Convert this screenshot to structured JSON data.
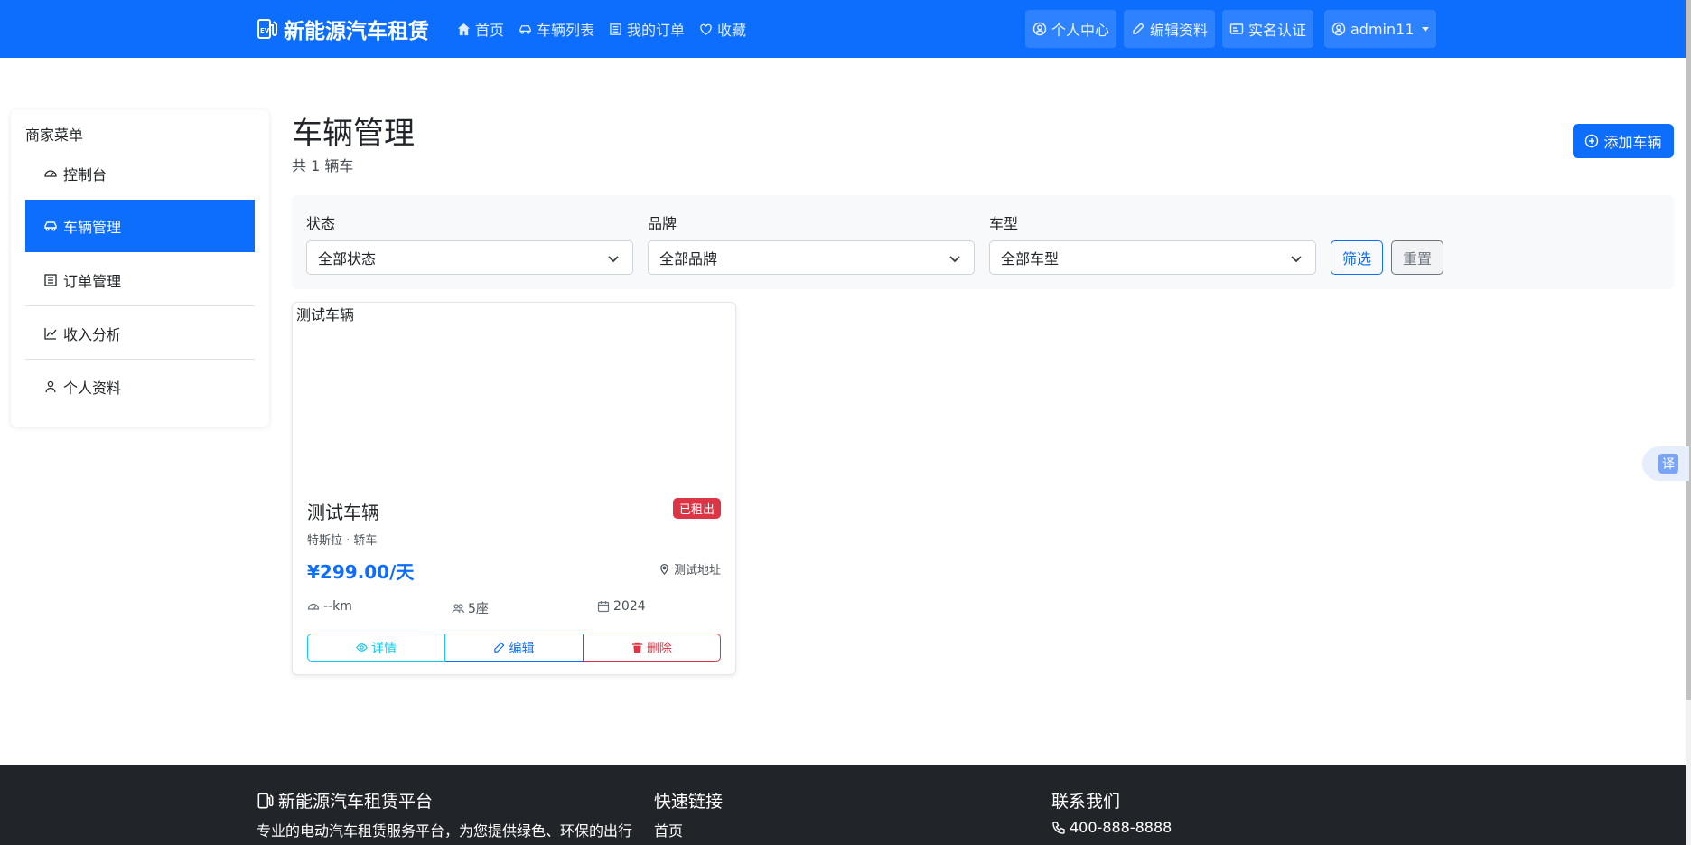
{
  "navbar": {
    "brand": "新能源汽车租赁",
    "links": [
      {
        "label": "首页",
        "icon": "home-icon"
      },
      {
        "label": "车辆列表",
        "icon": "car-icon"
      },
      {
        "label": "我的订单",
        "icon": "list-icon"
      },
      {
        "label": "收藏",
        "icon": "heart-icon"
      }
    ],
    "right": [
      {
        "label": "个人中心",
        "icon": "user-circle-icon"
      },
      {
        "label": "编辑资料",
        "icon": "pencil-icon"
      },
      {
        "label": "实名认证",
        "icon": "id-card-icon"
      },
      {
        "label": "admin11",
        "icon": "user-circle-icon"
      }
    ]
  },
  "sidebar": {
    "title": "商家菜单",
    "items": [
      {
        "label": "控制台",
        "icon": "speedometer-icon"
      },
      {
        "label": "车辆管理",
        "icon": "car-icon",
        "active": true
      },
      {
        "label": "订单管理",
        "icon": "list-icon"
      },
      {
        "label": "收入分析",
        "icon": "graph-icon"
      },
      {
        "label": "个人资料",
        "icon": "person-icon"
      }
    ]
  },
  "main": {
    "title": "车辆管理",
    "subtitle": "共 1 辆车",
    "add_button": "添加车辆"
  },
  "filters": {
    "status_label": "状态",
    "status_value": "全部状态",
    "brand_label": "品牌",
    "brand_value": "全部品牌",
    "type_label": "车型",
    "type_value": "全部车型",
    "filter_button": "筛选",
    "reset_button": "重置"
  },
  "vehicle": {
    "image_alt": "测试车辆",
    "name": "测试车辆",
    "status": "已租出",
    "meta": "特斯拉 · 轿车",
    "price": "¥299.00/天",
    "location": "测试地址",
    "mileage": "--km",
    "seats": "5座",
    "year": "2024",
    "actions": {
      "detail": "详情",
      "edit": "编辑",
      "delete": "删除"
    }
  },
  "translate_widget": "译",
  "footer": {
    "about_title": "新能源汽车租赁平台",
    "about_text": "专业的电动汽车租赁服务平台，为您提供绿色、环保的出行",
    "links_title": "快速链接",
    "link_home": "首页",
    "contact_title": "联系我们",
    "phone": "400-888-8888"
  },
  "colors": {
    "primary": "#0d6efd",
    "danger": "#dc3545",
    "info": "#0dcaf0",
    "footer_bg": "#212529"
  }
}
